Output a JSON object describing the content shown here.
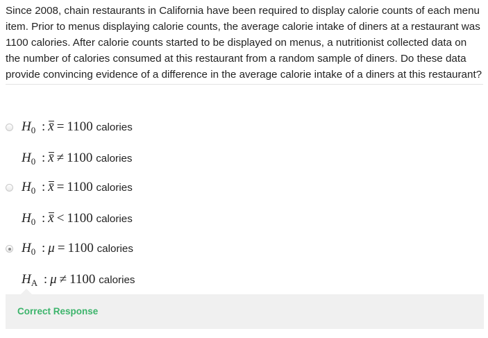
{
  "question": {
    "text": "Since 2008, chain restaurants in California have been required to display calorie counts of each menu item. Prior to menus displaying calorie counts, the average calorie intake of diners at a restaurant was 1100 calories. After calorie counts started to be displayed on menus, a nutritionist collected data on the number of calories consumed at this restaurant from a random sample of diners. Do these data provide convincing evidence of a difference in the average calorie intake of a diners at this restaurant?"
  },
  "choices": [
    {
      "selected": false,
      "line1": {
        "symbol": "H",
        "sub": "0",
        "param": "x̄",
        "op": "=",
        "value": "1100",
        "unit": "calories"
      },
      "line2": {
        "symbol": "H",
        "sub": "0",
        "param": "x̄",
        "op": "≠",
        "value": "1100",
        "unit": "calories"
      }
    },
    {
      "selected": false,
      "line1": {
        "symbol": "H",
        "sub": "0",
        "param": "x̄",
        "op": "=",
        "value": "1100",
        "unit": "calories"
      },
      "line2": {
        "symbol": "H",
        "sub": "0",
        "param": "x̄",
        "op": "<",
        "value": "1100",
        "unit": "calories"
      }
    },
    {
      "selected": true,
      "line1": {
        "symbol": "H",
        "sub": "0",
        "param": "μ",
        "op": "=",
        "value": "1100",
        "unit": "calories"
      },
      "line2": {
        "symbol": "H",
        "sub": "A",
        "param": "μ",
        "op": "≠",
        "value": "1100",
        "unit": "calories"
      }
    }
  ],
  "feedback": {
    "status": "Correct Response",
    "status_color": "#3cb46b"
  }
}
